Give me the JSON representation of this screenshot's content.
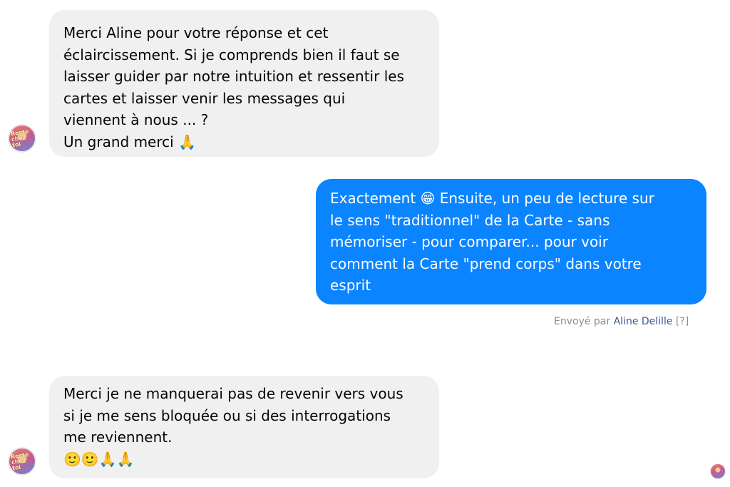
{
  "conversation": {
    "messages": [
      {
        "direction": "incoming",
        "text": "Merci Aline pour votre réponse et cet\néclaircissement. Si je comprends bien il faut se\nlaisser guider par notre intuition et ressentir les\ncartes et laisser venir les messages qui\nviennent à nous ... ?\nUn grand merci 🙏"
      },
      {
        "direction": "outgoing",
        "text": "Exactement 😁 Ensuite, un peu de lecture sur\nle sens \"traditionnel\" de la Carte - sans\nmémoriser - pour comparer... pour voir\ncomment la Carte \"prend corps\" dans votre\nesprit"
      },
      {
        "direction": "incoming",
        "text": "Merci je ne manquerai pas de revenir vers vous\nsi je me sens bloquée ou si des interrogations\nme reviennent.\n🙂🙂🙏🙏"
      }
    ],
    "sent_by": {
      "prefix": "Envoyé par",
      "name": "Aline Delille",
      "help": "[?]"
    },
    "avatar_text": "Reste chez toi"
  },
  "colors": {
    "incoming_bg": "#f0f0f0",
    "outgoing_bg": "#0b84ff",
    "meta_text": "#8a8d91",
    "name_link": "#385898"
  },
  "icons": [
    "user-avatar",
    "read-receipt-avatar"
  ]
}
